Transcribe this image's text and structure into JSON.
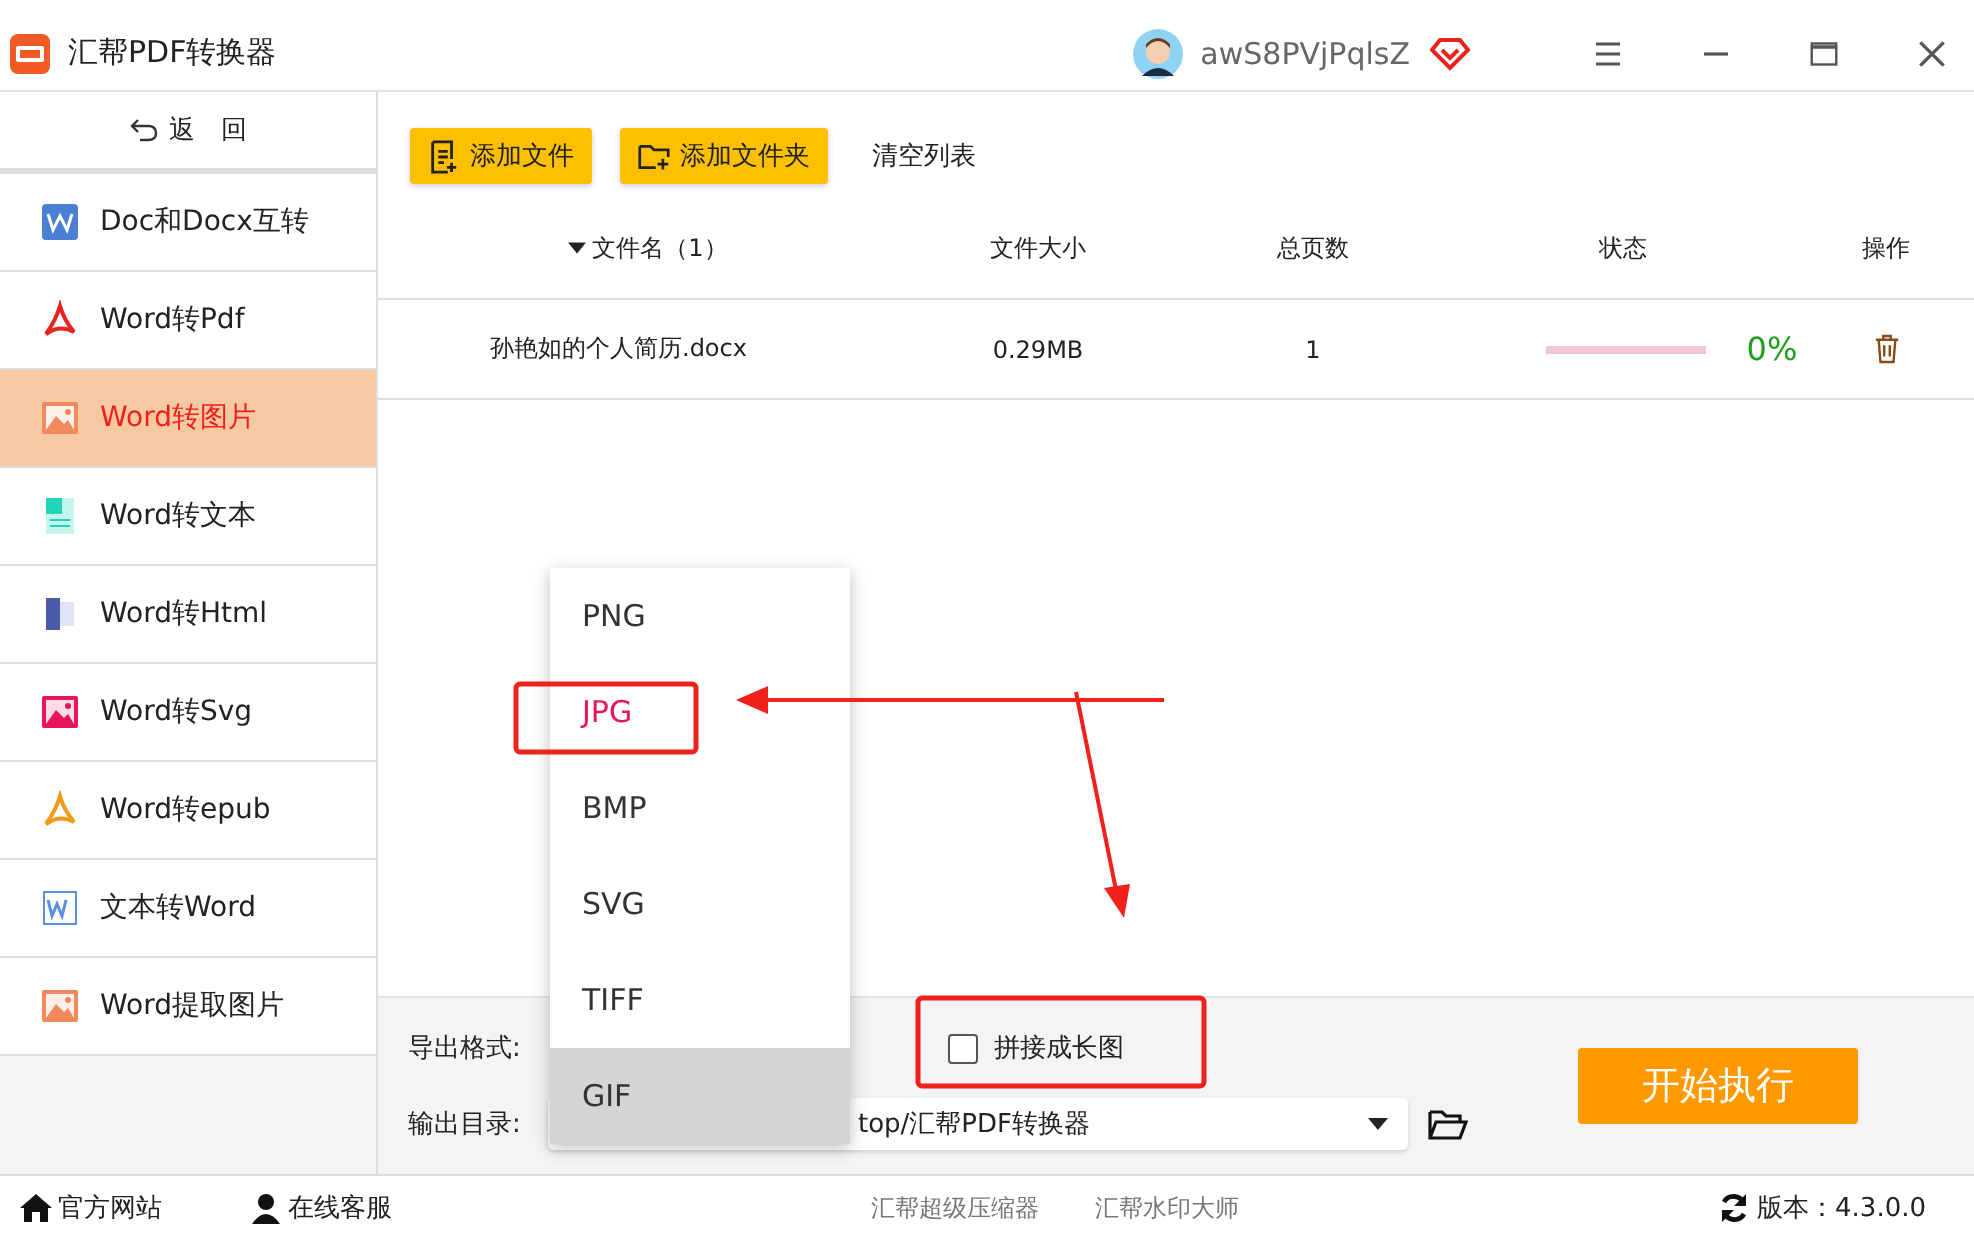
{
  "window": {
    "title": "汇帮PDF转换器",
    "username": "awS8PVjPqlsZ"
  },
  "sidebar": {
    "back": "返　回",
    "items": [
      {
        "label": "Doc和Docx互转",
        "selected": false
      },
      {
        "label": "Word转Pdf",
        "selected": false
      },
      {
        "label": "Word转图片",
        "selected": true
      },
      {
        "label": "Word转文本",
        "selected": false
      },
      {
        "label": "Word转Html",
        "selected": false
      },
      {
        "label": "Word转Svg",
        "selected": false
      },
      {
        "label": "Word转epub",
        "selected": false
      },
      {
        "label": "文本转Word",
        "selected": false
      },
      {
        "label": "Word提取图片",
        "selected": false
      }
    ]
  },
  "toolbar": {
    "add_file": "添加文件",
    "add_folder": "添加文件夹",
    "clear": "清空列表"
  },
  "table": {
    "columns": [
      "文件名（1）",
      "文件大小",
      "总页数",
      "状态",
      "操作"
    ],
    "rows": [
      {
        "name": "孙艳如的个人简历.docx",
        "size": "0.29MB",
        "pages": "1",
        "level": 0,
        "progress": "0%"
      }
    ]
  },
  "settings": {
    "format_label": "导出格式:",
    "merge_label": "拼接成长图",
    "merge_checked": false,
    "output_label": "输出目录:",
    "output_path": "top/汇帮PDF转换器",
    "start": "开始执行"
  },
  "format_menu": [
    {
      "label": "PNG",
      "selected": false,
      "hovered": false
    },
    {
      "label": "JPG",
      "selected": true,
      "hovered": false
    },
    {
      "label": "BMP",
      "selected": false,
      "hovered": false
    },
    {
      "label": "SVG",
      "selected": false,
      "hovered": false
    },
    {
      "label": "TIFF",
      "selected": false,
      "hovered": false
    },
    {
      "label": "GIF",
      "selected": false,
      "hovered": true
    }
  ],
  "status_bar": {
    "website": "官方网站",
    "support": "在线客服",
    "links": [
      "汇帮超级压缩器",
      "汇帮水印大师"
    ],
    "version": "版本：4.3.0.0"
  }
}
